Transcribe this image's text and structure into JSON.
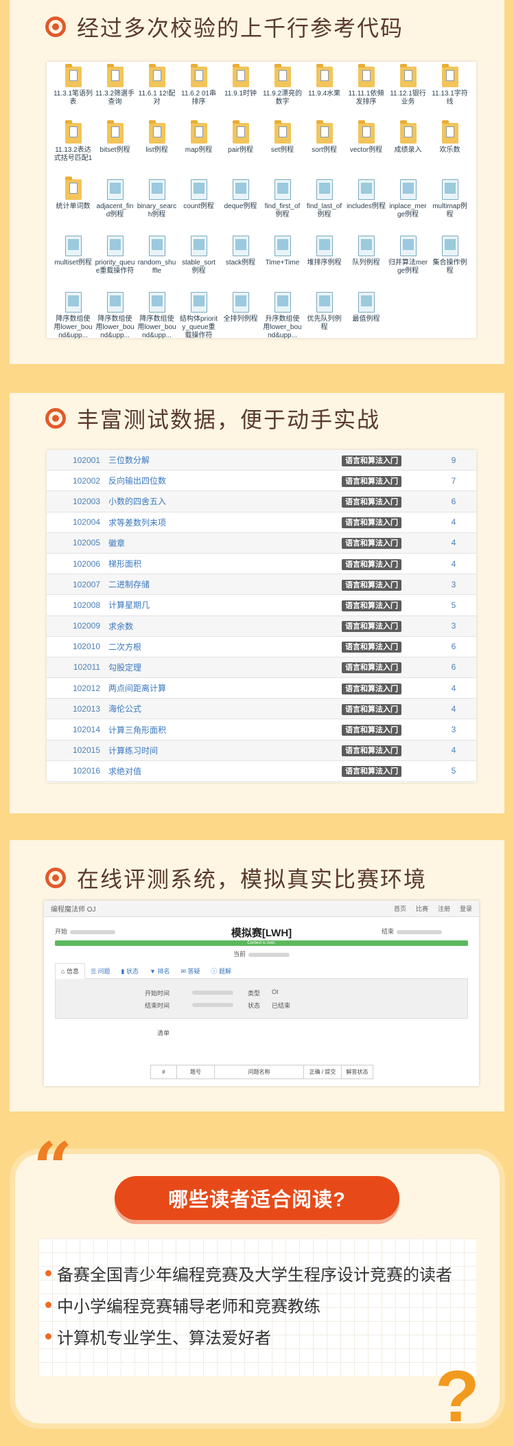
{
  "sections": {
    "code": {
      "title": "经过多次校验的上千行参考代码"
    },
    "testdata": {
      "title": "丰富测试数据，便于动手实战"
    },
    "oj": {
      "title": "在线评测系统，模拟真实比赛环境"
    }
  },
  "files": [
    {
      "label": "11.3.1笔语列表",
      "icon": "folder"
    },
    {
      "label": "11.3.2筛選手查询",
      "icon": "folder"
    },
    {
      "label": "11.6.1 12!配对",
      "icon": "folder"
    },
    {
      "label": "11.6.2 01串排序",
      "icon": "folder"
    },
    {
      "label": "11.9.1时钟",
      "icon": "folder"
    },
    {
      "label": "11.9.2漂亮的数字",
      "icon": "folder"
    },
    {
      "label": "11.9.4水果",
      "icon": "folder"
    },
    {
      "label": "11.11.1依頻发排序",
      "icon": "folder"
    },
    {
      "label": "11.12.1银行业务",
      "icon": "folder"
    },
    {
      "label": "11.13.1字符线",
      "icon": "folder"
    },
    {
      "label": "11.13.2表达式括号匹配1",
      "icon": "folder"
    },
    {
      "label": "bitset例程",
      "icon": "folder"
    },
    {
      "label": "list例程",
      "icon": "folder"
    },
    {
      "label": "map例程",
      "icon": "folder"
    },
    {
      "label": "pair例程",
      "icon": "folder"
    },
    {
      "label": "set例程",
      "icon": "folder"
    },
    {
      "label": "sort例程",
      "icon": "folder"
    },
    {
      "label": "vector例程",
      "icon": "folder"
    },
    {
      "label": "成绩录入",
      "icon": "folder"
    },
    {
      "label": "欢乐数",
      "icon": "folder"
    },
    {
      "label": "统计单词数",
      "icon": "folder"
    },
    {
      "label": "adjacent_find例程",
      "icon": "doc"
    },
    {
      "label": "binary_search例程",
      "icon": "doc"
    },
    {
      "label": "count例程",
      "icon": "doc"
    },
    {
      "label": "deque例程",
      "icon": "doc"
    },
    {
      "label": "find_first_of例程",
      "icon": "doc"
    },
    {
      "label": "find_last_of例程",
      "icon": "doc"
    },
    {
      "label": "includes例程",
      "icon": "doc"
    },
    {
      "label": "inplace_merge例程",
      "icon": "doc"
    },
    {
      "label": "multimap例程",
      "icon": "doc"
    },
    {
      "label": "multiset例程",
      "icon": "doc"
    },
    {
      "label": "priority_queue重载操作符",
      "icon": "doc"
    },
    {
      "label": "random_shuffle",
      "icon": "doc"
    },
    {
      "label": "stable_sort例程",
      "icon": "doc"
    },
    {
      "label": "stack例程",
      "icon": "doc"
    },
    {
      "label": "Time+Time",
      "icon": "doc"
    },
    {
      "label": "堆排序例程",
      "icon": "doc"
    },
    {
      "label": "队列例程",
      "icon": "doc"
    },
    {
      "label": "归并算法merge例程",
      "icon": "doc"
    },
    {
      "label": "集合操作例程",
      "icon": "doc"
    },
    {
      "label": "降序数组使用lower_bound&upp...",
      "icon": "doc"
    },
    {
      "label": "降序数组使用lower_bound&upp...",
      "icon": "doc"
    },
    {
      "label": "降序数组使用lower_bound&upp...",
      "icon": "doc"
    },
    {
      "label": "结构体priority_queue重载操作符",
      "icon": "doc"
    },
    {
      "label": "全排列例程",
      "icon": "doc"
    },
    {
      "label": "升序数组使用lower_bound&upp...",
      "icon": "doc"
    },
    {
      "label": "优先队列例程",
      "icon": "doc"
    },
    {
      "label": "最值例程",
      "icon": "doc"
    }
  ],
  "problems": [
    {
      "id": "102001",
      "title": "三位数分解",
      "tag": "语言和算法入门",
      "count": "9"
    },
    {
      "id": "102002",
      "title": "反向输出四位数",
      "tag": "语言和算法入门",
      "count": "7"
    },
    {
      "id": "102003",
      "title": "小数的四舍五入",
      "tag": "语言和算法入门",
      "count": "6"
    },
    {
      "id": "102004",
      "title": "求等差数列末项",
      "tag": "语言和算法入门",
      "count": "4"
    },
    {
      "id": "102005",
      "title": "徽章",
      "tag": "语言和算法入门",
      "count": "4"
    },
    {
      "id": "102006",
      "title": "梯形面积",
      "tag": "语言和算法入门",
      "count": "4"
    },
    {
      "id": "102007",
      "title": "二进制存储",
      "tag": "语言和算法入门",
      "count": "3"
    },
    {
      "id": "102008",
      "title": "计算星期几",
      "tag": "语言和算法入门",
      "count": "5"
    },
    {
      "id": "102009",
      "title": "求余数",
      "tag": "语言和算法入门",
      "count": "3"
    },
    {
      "id": "102010",
      "title": "二次方根",
      "tag": "语言和算法入门",
      "count": "6"
    },
    {
      "id": "102011",
      "title": "勾股定理",
      "tag": "语言和算法入门",
      "count": "6"
    },
    {
      "id": "102012",
      "title": "两点间距离计算",
      "tag": "语言和算法入门",
      "count": "4"
    },
    {
      "id": "102013",
      "title": "海伦公式",
      "tag": "语言和算法入门",
      "count": "4"
    },
    {
      "id": "102014",
      "title": "计算三角形面积",
      "tag": "语言和算法入门",
      "count": "3"
    },
    {
      "id": "102015",
      "title": "计算练习时间",
      "tag": "语言和算法入门",
      "count": "4"
    },
    {
      "id": "102016",
      "title": "求绝对值",
      "tag": "语言和算法入门",
      "count": "5"
    }
  ],
  "oj": {
    "brand": "编程魔法师 OJ",
    "nav": [
      "首页",
      "比赛",
      "注册",
      "登录"
    ],
    "start_label": "开始",
    "end_label": "结束",
    "contest_title": "模拟赛[LWH]",
    "progress_text": "Contest is over.",
    "current_label": "当前",
    "tabs": [
      "信息",
      "问题",
      "状态",
      "排名",
      "答疑",
      "题解"
    ],
    "info": {
      "start_time_label": "开始时间",
      "end_time_label": "结束时间",
      "type_label": "类型",
      "type_value": "OI",
      "status_label": "状态",
      "status_value": "已结束"
    },
    "rank_label": "清单",
    "table_headers": [
      "#",
      "题号",
      "问题名称",
      "正确 / 提交",
      "解答状态"
    ]
  },
  "readers": {
    "heading": "哪些读者适合阅读?",
    "items": [
      "备赛全国青少年编程竞赛及大学生程序设计竞赛的读者",
      "中小学编程竞赛辅导老师和竞赛教练",
      "计算机专业学生、算法爱好者"
    ]
  },
  "colors": {
    "accent": "#e2592b",
    "pill": "#e74a18",
    "background": "#fcd888"
  }
}
